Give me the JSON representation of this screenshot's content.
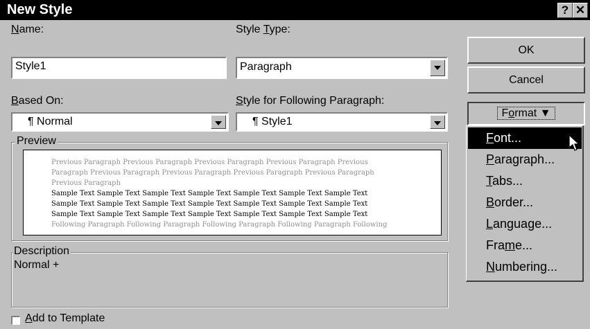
{
  "window": {
    "title": "New Style",
    "help_label": "?",
    "close_label": "✕"
  },
  "name": {
    "label_u": "N",
    "label_rest": "ame:",
    "value": "Style1"
  },
  "style_type": {
    "label_pre": "Style ",
    "label_u": "T",
    "label_rest": "ype:",
    "value": "Paragraph"
  },
  "based_on": {
    "label_u": "B",
    "label_rest": "ased On:",
    "value": "¶ Normal"
  },
  "following": {
    "label_u": "S",
    "label_rest": "tyle for Following Paragraph:",
    "value": "¶ Style1"
  },
  "preview": {
    "legend": "Preview",
    "lines": [
      {
        "text": "Previous Paragraph Previous Paragraph Previous Paragraph Previous Paragraph Previous",
        "style": "grey"
      },
      {
        "text": "Paragraph Previous Paragraph Previous Paragraph Previous Paragraph Previous Paragraph",
        "style": "grey"
      },
      {
        "text": "Previous Paragraph",
        "style": "grey"
      },
      {
        "text": "Sample Text Sample Text Sample Text Sample Text Sample Text Sample Text Sample Text",
        "style": "black"
      },
      {
        "text": "Sample Text Sample Text Sample Text Sample Text Sample Text Sample Text Sample Text",
        "style": "black"
      },
      {
        "text": "Sample Text Sample Text Sample Text Sample Text Sample Text Sample Text Sample Text",
        "style": "black"
      },
      {
        "text": "Following Paragraph Following Paragraph Following Paragraph Following Paragraph Following",
        "style": "grey"
      }
    ]
  },
  "description": {
    "legend": "Description",
    "text": "Normal +"
  },
  "add_template": {
    "label_u": "A",
    "label_rest": "dd to Template",
    "checked": false
  },
  "buttons": {
    "ok": "OK",
    "cancel": "Cancel",
    "format_pre": "F",
    "format_u": "o",
    "format_rest": "rmat"
  },
  "format_menu": [
    {
      "u": "F",
      "rest": "ont...",
      "pre": "",
      "selected": true
    },
    {
      "u": "P",
      "rest": "aragraph...",
      "pre": "",
      "selected": false
    },
    {
      "u": "T",
      "rest": "abs...",
      "pre": "",
      "selected": false
    },
    {
      "u": "B",
      "rest": "order...",
      "pre": "",
      "selected": false
    },
    {
      "u": "L",
      "rest": "anguage...",
      "pre": "",
      "selected": false
    },
    {
      "u": "m",
      "rest": "e...",
      "pre": "Fra",
      "selected": false
    },
    {
      "u": "N",
      "rest": "umbering...",
      "pre": "",
      "selected": false
    }
  ]
}
